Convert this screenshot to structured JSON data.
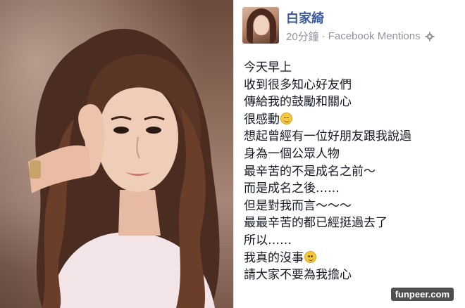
{
  "photo": {
    "alt_subject": "selfie-portrait"
  },
  "post": {
    "author": "白家綺",
    "timestamp": "20分鐘",
    "separator": "·",
    "source": "Facebook Mentions",
    "lines": [
      "今天早上",
      "收到很多知心好友們",
      "傳給我的鼓勵和關心",
      "很感動",
      "想起曾經有一位好朋友跟我說過",
      "身為一個公眾人物",
      "最辛苦的不是成名之前～",
      "而是成名之後……",
      "但是對我而言～～～",
      "最最辛苦的都已經挺過去了",
      "所以……",
      "我真的沒事",
      "請大家不要為我擔心"
    ],
    "emoji_relieved": "relieved-face-icon",
    "emoji_smile": "smiling-face-icon"
  },
  "watermark": "funpeer.com",
  "colors": {
    "author_link": "#3b5998",
    "meta_text": "#90949c",
    "body_text": "#141823"
  }
}
